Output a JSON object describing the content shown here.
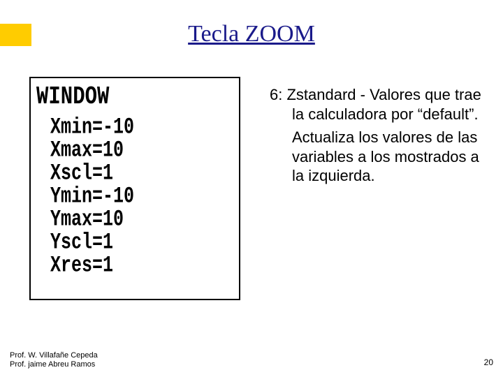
{
  "accentColor": "#ffcc00",
  "title": "Tecla ZOOM",
  "calculator": {
    "header": "WINDOW",
    "lines": [
      "Xmin=-10",
      "Xmax=10",
      "Xscl=1",
      "Ymin=-10",
      "Ymax=10",
      "Yscl=1",
      "Xres=1"
    ]
  },
  "description": {
    "para1": "6: Zstandard - Valores que trae la calculadora por “default”.",
    "para2": "Actualiza los valores de las variables a los mostrados a la izquierda."
  },
  "footer": {
    "line1": "Prof. W. Villafañe Cepeda",
    "line2": "Prof. jaime Abreu Ramos"
  },
  "pageNumber": "20"
}
